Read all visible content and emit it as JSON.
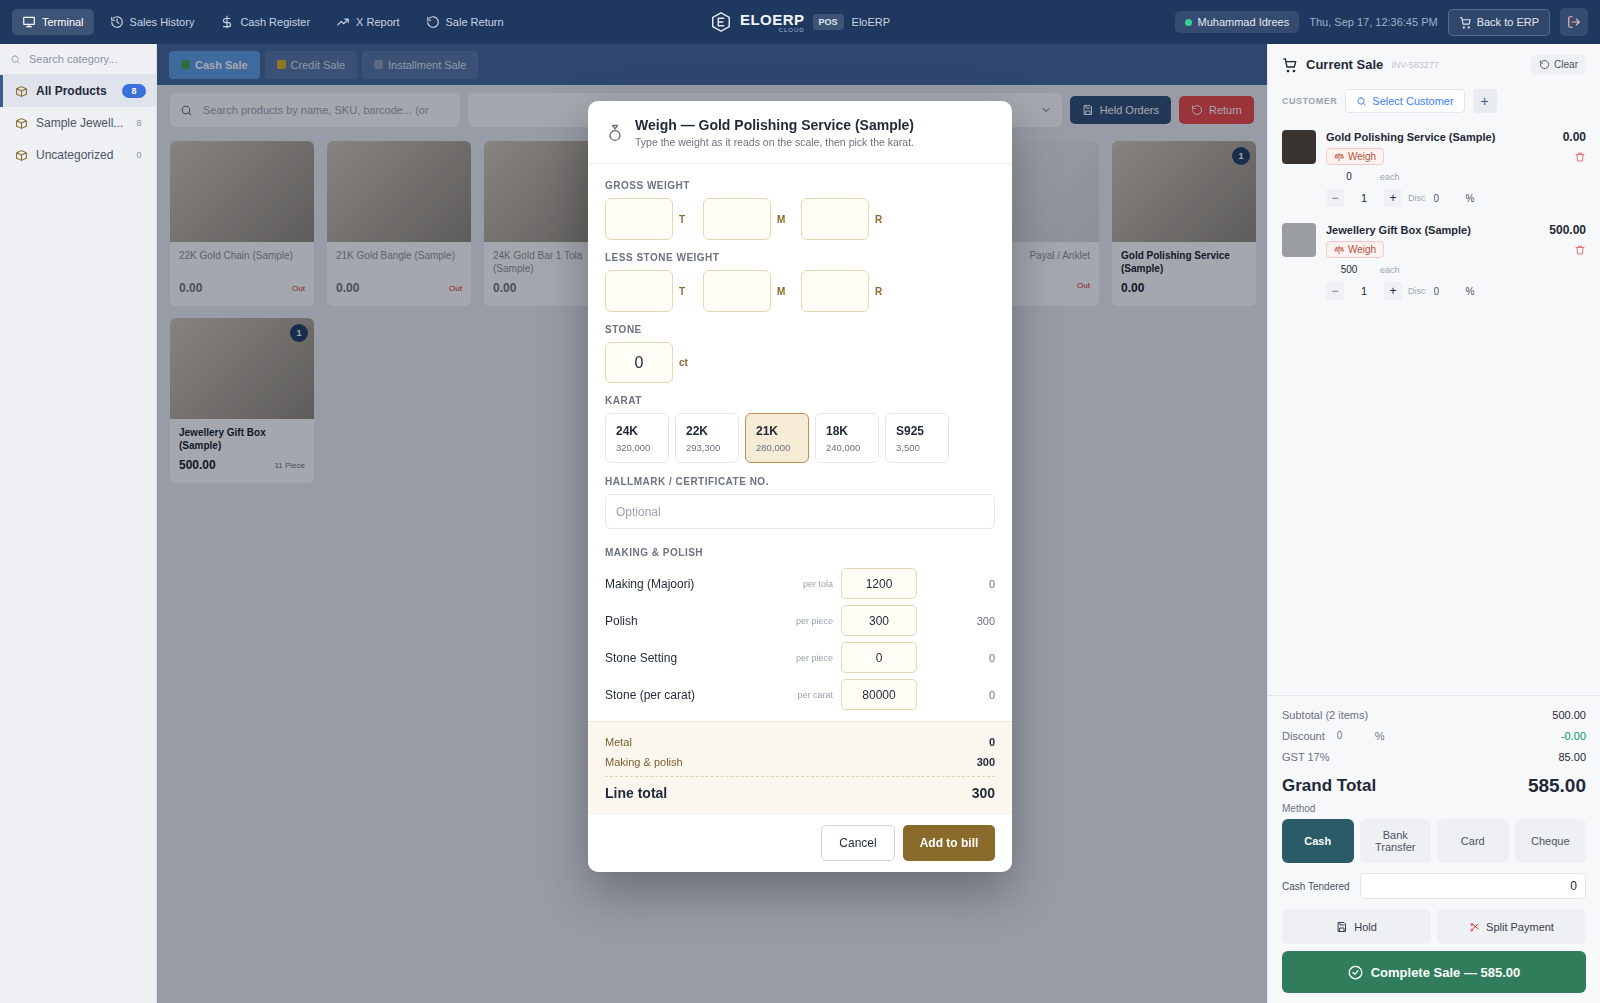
{
  "topbar": {
    "nav": [
      {
        "label": "Terminal",
        "selected": true
      },
      {
        "label": "Sales History",
        "selected": false
      },
      {
        "label": "Cash Register",
        "selected": false
      },
      {
        "label": "X Report",
        "selected": false
      },
      {
        "label": "Sale Return",
        "selected": false
      }
    ],
    "logo": {
      "text": "ELOERP",
      "sub": "CLOUD",
      "badge": "POS"
    },
    "app_name": "EloERP",
    "user": "Muhammad Idrees",
    "online": true,
    "datetime": "Thu, Sep 17, 12:36:45 PM",
    "back_button": "Back to ERP"
  },
  "sidebar": {
    "search_placeholder": "Search category...",
    "items": [
      {
        "label": "All Products",
        "count": "8",
        "selected": true
      },
      {
        "label": "Sample Jewell...",
        "count": "8",
        "selected": false
      },
      {
        "label": "Uncategorized",
        "count": "0",
        "selected": false
      }
    ]
  },
  "sale_tabs": [
    {
      "label": "Cash Sale",
      "selected": true
    },
    {
      "label": "Credit Sale",
      "selected": false
    },
    {
      "label": "Installment Sale",
      "selected": false
    }
  ],
  "product_search": {
    "placeholder": "Search products by name, SKU, barcode... (or"
  },
  "held_orders": "Held Orders",
  "return": "Return",
  "products": [
    {
      "kind": "normal",
      "name": "22K Gold Chain (Sample)",
      "price": "0.00",
      "stock": "Out",
      "out_of_stock": true,
      "badge": ""
    },
    {
      "kind": "normal",
      "name": "21K Gold Bangle (Sample)",
      "price": "0.00",
      "stock": "Out",
      "out_of_stock": true,
      "badge": ""
    },
    {
      "kind": "normal",
      "name": "24K Gold Bar 1 Tola (Sample)",
      "price": "0.00",
      "stock": "",
      "out_of_stock": true,
      "badge": ""
    },
    {
      "kind": "covered"
    },
    {
      "kind": "covered"
    },
    {
      "kind": "partial",
      "name": "Payal / Anklet",
      "price": "",
      "stock": "Out",
      "out_of_stock": true,
      "badge": ""
    },
    {
      "kind": "normal",
      "name": "Gold Polishing Service (Sample)",
      "price": "0.00",
      "stock": "",
      "out_of_stock": false,
      "badge": "1"
    },
    {
      "kind": "normal",
      "name": "Jewellery Gift Box (Sample)",
      "price": "500.00",
      "stock": "11 Piece",
      "out_of_stock": false,
      "badge": "1"
    }
  ],
  "cart": {
    "title": "Current Sale",
    "invoice": "INV-583277",
    "clear": "Clear",
    "customer_label": "CUSTOMER",
    "select_customer": "Select Customer",
    "add": "+",
    "items": [
      {
        "name": "Gold Polishing Service (Sample)",
        "total": "0.00",
        "weigh": "Weigh",
        "unit_price": "0",
        "each": "each",
        "minus": "−",
        "qty": "1",
        "plus": "+",
        "disc_label": "Disc",
        "disc": "0",
        "pct": "%"
      },
      {
        "name": "Jewellery Gift Box (Sample)",
        "total": "500.00",
        "weigh": "Weigh",
        "unit_price": "500",
        "each": "each",
        "minus": "−",
        "qty": "1",
        "plus": "+",
        "disc_label": "Disc",
        "disc": "0",
        "pct": "%"
      }
    ],
    "subtotal": {
      "label": "Subtotal (2 items)",
      "value": "500.00"
    },
    "discount": {
      "label": "Discount",
      "input": "0",
      "pct": "%",
      "value": "-0.00"
    },
    "gst": {
      "label": "GST 17%",
      "value": "85.00"
    },
    "grand_total": {
      "label": "Grand Total",
      "value": "585.00"
    },
    "method_label": "Method",
    "methods": [
      {
        "label": "Cash",
        "selected": true
      },
      {
        "label": "Bank Transfer",
        "selected": false
      },
      {
        "label": "Card",
        "selected": false
      },
      {
        "label": "Cheque",
        "selected": false
      }
    ],
    "cash_tendered": {
      "label": "Cash Tendered",
      "value": "0"
    },
    "hold": "Hold",
    "split": "Split Payment",
    "complete": "Complete Sale — 585.00"
  },
  "modal": {
    "title": "Weigh — Gold Polishing Service (Sample)",
    "subtitle": "Type the weight as it reads on the scale, then pick the karat.",
    "gross": {
      "label": "GROSS WEIGHT",
      "fields": [
        {
          "value": "",
          "unit": "T"
        },
        {
          "value": "",
          "unit": "M"
        },
        {
          "value": "",
          "unit": "R"
        }
      ]
    },
    "less_stone": {
      "label": "LESS STONE WEIGHT",
      "fields": [
        {
          "value": "",
          "unit": "T"
        },
        {
          "value": "",
          "unit": "M"
        },
        {
          "value": "",
          "unit": "R"
        }
      ]
    },
    "stone": {
      "label": "STONE",
      "value": "0",
      "unit": "ct"
    },
    "karat": {
      "label": "KARAT",
      "options": [
        {
          "label": "24K",
          "rate": "320,000",
          "selected": false
        },
        {
          "label": "22K",
          "rate": "293,300",
          "selected": false
        },
        {
          "label": "21K",
          "rate": "280,000",
          "selected": true
        },
        {
          "label": "18K",
          "rate": "240,000",
          "selected": false
        },
        {
          "label": "S925",
          "rate": "3,500",
          "selected": false
        }
      ]
    },
    "hallmark": {
      "label": "HALLMARK / CERTIFICATE NO.",
      "placeholder": "Optional",
      "value": ""
    },
    "making": {
      "label": "MAKING & POLISH",
      "rows": [
        {
          "label": "Making (Majoori)",
          "unit": "per tola",
          "value": "1200",
          "amount": "0"
        },
        {
          "label": "Polish",
          "unit": "per piece",
          "value": "300",
          "amount": "300"
        },
        {
          "label": "Stone Setting",
          "unit": "per piece",
          "value": "0",
          "amount": "0"
        },
        {
          "label": "Stone (per carat)",
          "unit": "per carat",
          "value": "80000",
          "amount": "0"
        }
      ]
    },
    "summary": [
      {
        "label": "Metal",
        "value": "0"
      },
      {
        "label": "Making & polish",
        "value": "300"
      }
    ],
    "line_total": {
      "label": "Line total",
      "value": "300"
    },
    "buttons": {
      "cancel": "Cancel",
      "add": "Add to bill"
    }
  }
}
